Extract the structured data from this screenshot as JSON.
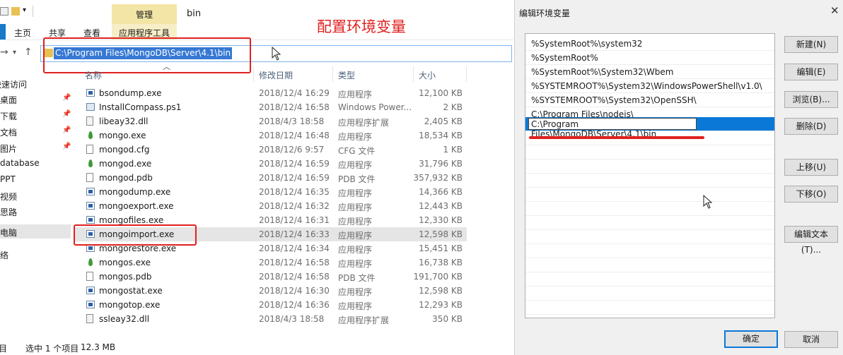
{
  "annotation": {
    "title": "配置环境变量"
  },
  "explorer": {
    "window_title": "bin",
    "contextual_tab_group": "管理",
    "contextual_tab": "应用程序工具",
    "ribbon_tabs": [
      "主页",
      "共享",
      "查看"
    ],
    "address": "C:\\Program Files\\MongoDB\\Server\\4.1\\bin",
    "columns": {
      "name": "名称",
      "date": "修改日期",
      "type": "类型",
      "size": "大小"
    },
    "nav_items": [
      {
        "label": "快速访问",
        "pinned": false
      },
      {
        "label": "桌面",
        "pinned": true
      },
      {
        "label": "下载",
        "pinned": true
      },
      {
        "label": "文档",
        "pinned": true
      },
      {
        "label": "图片",
        "pinned": true
      },
      {
        "label": "database",
        "pinned": false
      },
      {
        "label": "PPT",
        "pinned": false
      },
      {
        "label": "视频",
        "pinned": false
      },
      {
        "label": "思路",
        "pinned": false
      },
      {
        "label": "此电脑",
        "pinned": false,
        "selected": true
      },
      {
        "label": "网络",
        "pinned": false
      }
    ],
    "files": [
      {
        "name": "bsondump.exe",
        "date": "2018/12/4 16:29",
        "type": "应用程序",
        "size": "12,100 KB",
        "icon": "exe-icon"
      },
      {
        "name": "InstallCompass.ps1",
        "date": "2018/12/4 16:58",
        "type": "Windows Power...",
        "size": "2 KB",
        "icon": "powershell-script-icon"
      },
      {
        "name": "libeay32.dll",
        "date": "2018/4/3 18:58",
        "type": "应用程序扩展",
        "size": "2,405 KB",
        "icon": "dll-icon"
      },
      {
        "name": "mongo.exe",
        "date": "2018/12/4 16:48",
        "type": "应用程序",
        "size": "18,534 KB",
        "icon": "mongodb-leaf-icon"
      },
      {
        "name": "mongod.cfg",
        "date": "2018/12/6 9:57",
        "type": "CFG 文件",
        "size": "1 KB",
        "icon": "file-icon"
      },
      {
        "name": "mongod.exe",
        "date": "2018/12/4 16:59",
        "type": "应用程序",
        "size": "31,796 KB",
        "icon": "mongodb-leaf-icon"
      },
      {
        "name": "mongod.pdb",
        "date": "2018/12/4 16:59",
        "type": "PDB 文件",
        "size": "357,932 KB",
        "icon": "file-icon"
      },
      {
        "name": "mongodump.exe",
        "date": "2018/12/4 16:35",
        "type": "应用程序",
        "size": "14,366 KB",
        "icon": "exe-icon"
      },
      {
        "name": "mongoexport.exe",
        "date": "2018/12/4 16:32",
        "type": "应用程序",
        "size": "12,443 KB",
        "icon": "exe-icon"
      },
      {
        "name": "mongofiles.exe",
        "date": "2018/12/4 16:31",
        "type": "应用程序",
        "size": "12,330 KB",
        "icon": "exe-icon"
      },
      {
        "name": "mongoimport.exe",
        "date": "2018/12/4 16:33",
        "type": "应用程序",
        "size": "12,598 KB",
        "icon": "exe-icon",
        "selected": true
      },
      {
        "name": "mongorestore.exe",
        "date": "2018/12/4 16:34",
        "type": "应用程序",
        "size": "15,451 KB",
        "icon": "exe-icon"
      },
      {
        "name": "mongos.exe",
        "date": "2018/12/4 16:58",
        "type": "应用程序",
        "size": "16,738 KB",
        "icon": "mongodb-leaf-icon"
      },
      {
        "name": "mongos.pdb",
        "date": "2018/12/4 16:58",
        "type": "PDB 文件",
        "size": "191,700 KB",
        "icon": "file-icon"
      },
      {
        "name": "mongostat.exe",
        "date": "2018/12/4 16:30",
        "type": "应用程序",
        "size": "12,598 KB",
        "icon": "exe-icon"
      },
      {
        "name": "mongotop.exe",
        "date": "2018/12/4 16:36",
        "type": "应用程序",
        "size": "12,293 KB",
        "icon": "exe-icon"
      },
      {
        "name": "ssleay32.dll",
        "date": "2018/4/3 18:58",
        "type": "应用程序扩展",
        "size": "350 KB",
        "icon": "dll-icon"
      }
    ],
    "status": {
      "items": "项目",
      "selected": "选中 1 个项目",
      "size": "12.3 MB"
    }
  },
  "dialog": {
    "title": "编辑环境变量",
    "close": "✕",
    "entries": [
      "%SystemRoot%\\system32",
      "%SystemRoot%",
      "%SystemRoot%\\System32\\Wbem",
      "%SYSTEMROOT%\\System32\\WindowsPowerShell\\v1.0\\",
      "%SYSTEMROOT%\\System32\\OpenSSH\\",
      "C:\\Program Files\\nodejs\\",
      "C:\\Program Files\\MongoDB\\Server\\4.1\\bin"
    ],
    "buttons": {
      "new": "新建(N)",
      "edit": "编辑(E)",
      "browse": "浏览(B)...",
      "delete": "删除(D)",
      "move_up": "上移(U)",
      "move_down": "下移(O)",
      "edit_text": "编辑文本(T)...",
      "ok": "确定",
      "cancel": "取消"
    }
  }
}
